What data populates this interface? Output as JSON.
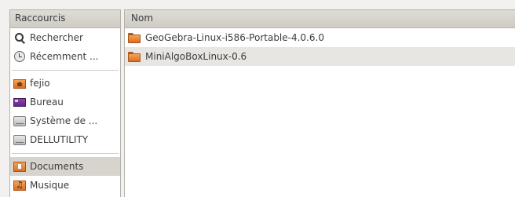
{
  "sidebar": {
    "header": "Raccourcis",
    "items": [
      {
        "label": "Rechercher",
        "icon": "search-icon"
      },
      {
        "label": "Récemment ...",
        "icon": "recent-icon"
      },
      {
        "label": "fejio",
        "icon": "home-folder-icon"
      },
      {
        "label": "Bureau",
        "icon": "desktop-icon"
      },
      {
        "label": "Système de ...",
        "icon": "drive-icon"
      },
      {
        "label": "DELLUTILITY",
        "icon": "drive-icon"
      },
      {
        "label": "Documents",
        "icon": "documents-folder-icon",
        "selected": true
      },
      {
        "label": "Musique",
        "icon": "music-folder-icon"
      }
    ]
  },
  "files": {
    "column_header": "Nom",
    "rows": [
      {
        "name": "GeoGebra-Linux-i586-Portable-4.0.6.0",
        "icon": "folder-icon"
      },
      {
        "name": "MiniAlgoBoxLinux-0.6",
        "icon": "folder-icon"
      }
    ]
  },
  "colors": {
    "folder_orange": "#e8893a",
    "selected_bg": "#d7d3cd",
    "header_bg": "#d6d2cc"
  }
}
